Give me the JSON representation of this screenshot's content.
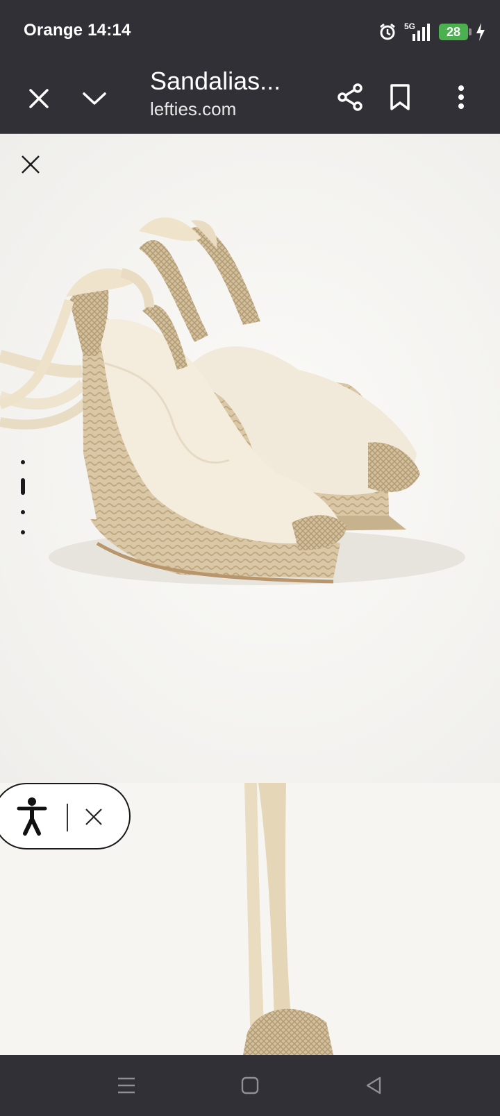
{
  "status_bar": {
    "carrier": "Orange",
    "time": "14:14",
    "network": "5G",
    "battery_level": "28"
  },
  "toolbar": {
    "title": "Sandalias...",
    "url": "lefties.com"
  },
  "colors": {
    "chrome": "#303036",
    "battery": "#4caf50",
    "product": "#efe6d4"
  },
  "gallery": {
    "image_count": 4,
    "active_index": 1
  },
  "icons": [
    "close-icon",
    "chevron-down-icon",
    "share-icon",
    "bookmark-icon",
    "more-vert-icon",
    "close-gallery-icon",
    "accessibility-icon",
    "alarm-icon",
    "signal-icon",
    "battery-icon",
    "charging-icon",
    "menu-icon",
    "home-icon",
    "back-icon"
  ]
}
